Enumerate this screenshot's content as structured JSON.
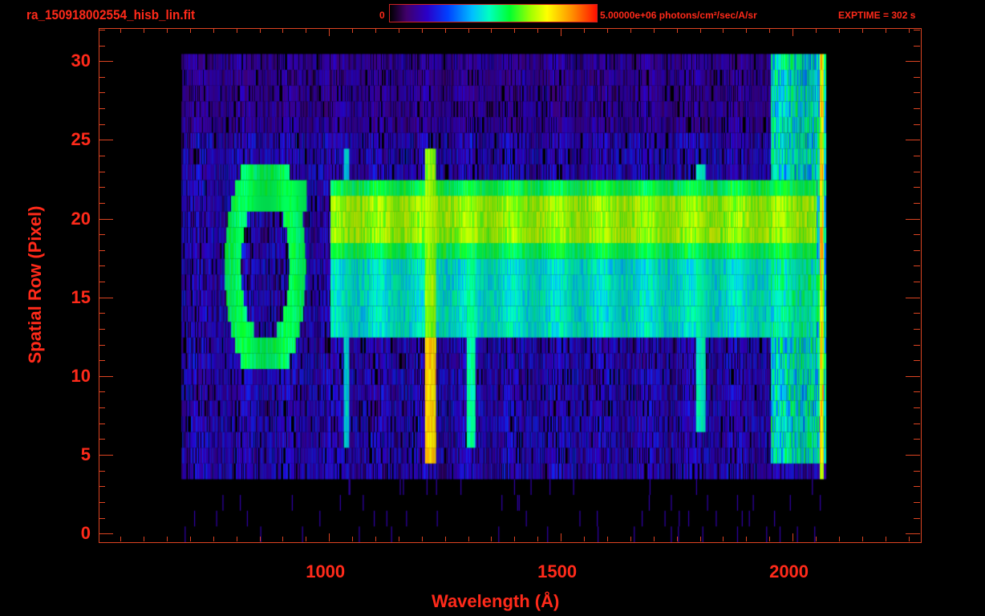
{
  "header": {
    "title": "ra_150918002554_hisb_lin.fit",
    "colorbar_min": "0",
    "colorbar_max": "5.00000e+06 photons/cm²/sec/A/sr",
    "exptime": "EXPTIME = 302 s"
  },
  "chart_data": {
    "type": "heatmap",
    "title": "ra_150918002554_hisb_lin.fit",
    "xlabel": "Wavelength (Å)",
    "ylabel": "Spatial Row (Pixel)",
    "xlim": [
      503,
      2275
    ],
    "ylim": [
      -0.5,
      32.1
    ],
    "xticks": [
      1000,
      1500,
      2000
    ],
    "xtick_labels": [
      "1000",
      "1500",
      "2000"
    ],
    "yticks": [
      0,
      5,
      10,
      15,
      20,
      25,
      30
    ],
    "ytick_labels": [
      "0",
      "5",
      "10",
      "15",
      "20",
      "25",
      "30"
    ],
    "colorbar": {
      "min": 0,
      "max": 5000000,
      "units": "photons/cm^2/sec/A/sr",
      "colormap": "rainbow"
    },
    "data_extent": {
      "wavelength": [
        680,
        2070
      ],
      "rows": [
        0,
        30
      ]
    },
    "features": [
      {
        "name": "slit band bright",
        "rows": [
          18,
          22
        ],
        "wavelength": [
          1000,
          2050
        ],
        "level": 0.7
      },
      {
        "name": "slit band lower",
        "rows": [
          13,
          17
        ],
        "wavelength": [
          1000,
          2050
        ],
        "level": 0.45
      },
      {
        "name": "ring feature",
        "rows": [
          11,
          23
        ],
        "wavelength": [
          790,
          940
        ],
        "level": 0.55
      },
      {
        "name": "Lyman alpha",
        "rows": [
          5,
          24
        ],
        "wavelength": 1216,
        "level": 0.8
      },
      {
        "name": "OI 1304",
        "rows": [
          6,
          18
        ],
        "wavelength": 1304,
        "level": 0.5
      },
      {
        "name": "line 1035",
        "rows": [
          6,
          24
        ],
        "wavelength": 1035,
        "level": 0.4
      },
      {
        "name": "line 1800",
        "rows": [
          7,
          23
        ],
        "wavelength": 1800,
        "level": 0.45
      },
      {
        "name": "detector edge",
        "rows": [
          0,
          30
        ],
        "wavelength": 2060,
        "level": 0.7
      }
    ]
  }
}
